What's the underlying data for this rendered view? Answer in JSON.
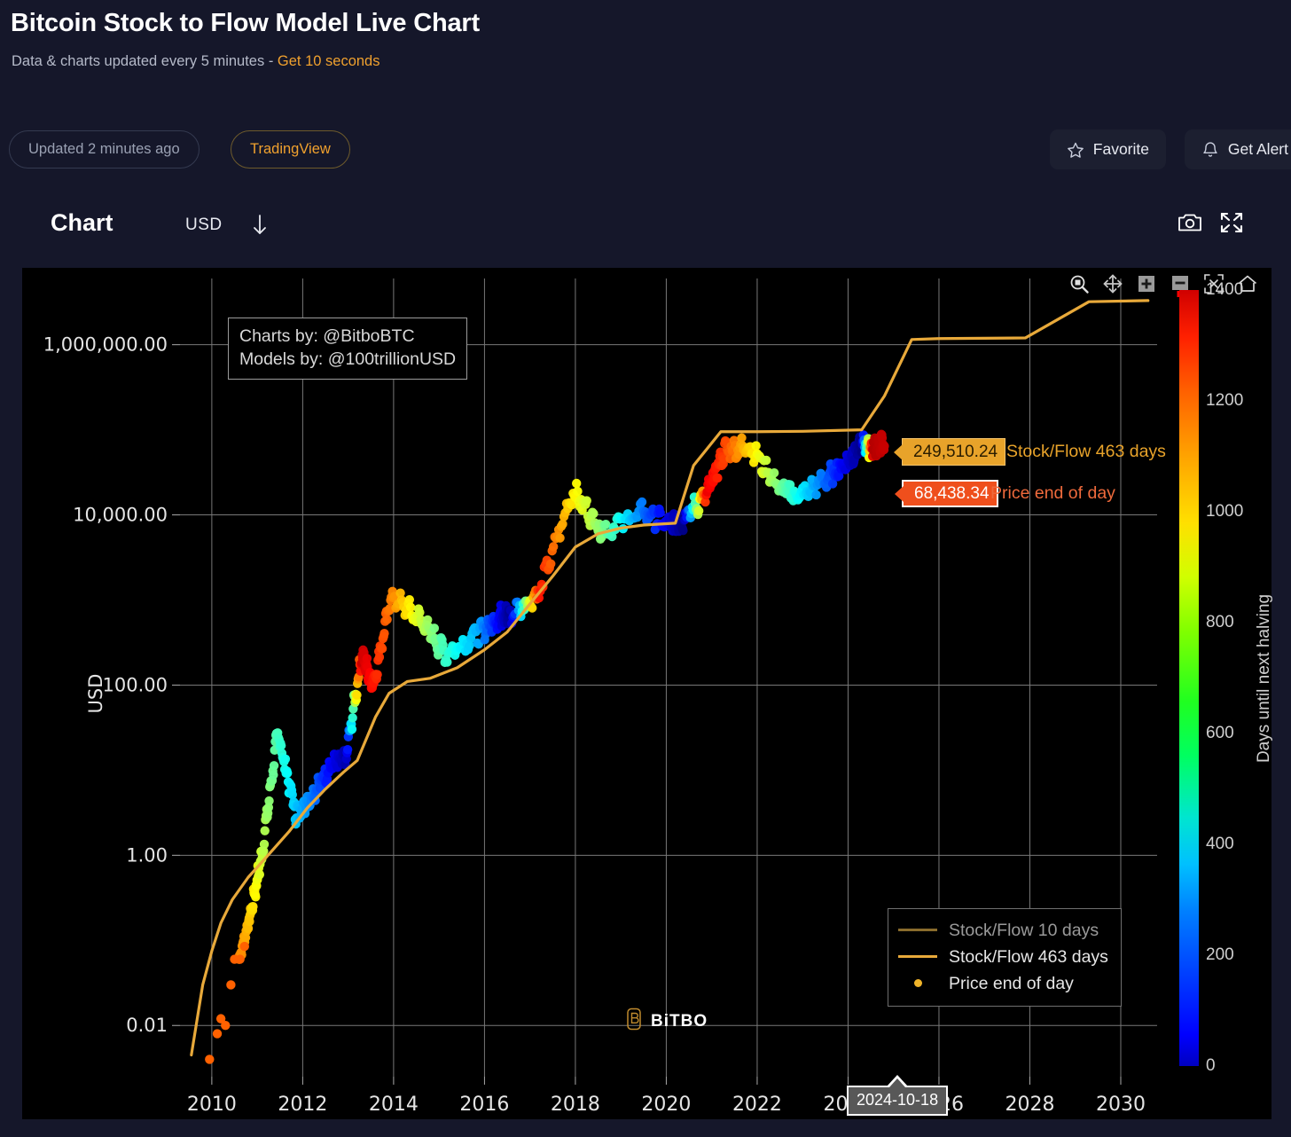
{
  "header": {
    "title": "Bitcoin Stock to Flow Model Live Chart",
    "subtitle_plain": "Data & charts updated every 5 minutes - ",
    "subtitle_accent": "Get 10 seconds",
    "updated_pill": "Updated 2 minutes ago",
    "tradingview_pill": "TradingView",
    "favorite_label": "Favorite",
    "alert_label": "Get Alert"
  },
  "chart_header": {
    "label": "Chart",
    "currency": "USD",
    "currency_arrow": "down-arrow-icon",
    "camera_icon": "camera-icon",
    "expand_icon": "expand-icon"
  },
  "chart_toolbar": {
    "items": [
      "zoom-box-icon",
      "pan-icon",
      "zoom-in-icon",
      "zoom-out-icon",
      "autoscale-icon",
      "home-icon"
    ]
  },
  "credits": {
    "line1": "Charts by: @BitboBTC",
    "line2": "Models by: @100trillionUSD"
  },
  "flags": {
    "stockflow_value": "249,510.24",
    "stockflow_label": "Stock/Flow 463 days",
    "price_value": "68,438.34",
    "price_label": "Price end of day"
  },
  "legend": {
    "items": [
      {
        "label": "Stock/Flow 10 days",
        "color": "#8a6c2d",
        "text_color": "#9a9a9a",
        "kind": "line"
      },
      {
        "label": "Stock/Flow 463 days",
        "color": "#e8a93a",
        "text_color": "#e6e6e6",
        "kind": "line"
      },
      {
        "label": "Price end of day",
        "color": "#f0b42a",
        "text_color": "#e6e6e6",
        "kind": "dot"
      }
    ]
  },
  "watermark": {
    "text": "BiTBO",
    "icon": "bitbo-logo-icon"
  },
  "x_tooltip": {
    "date": "2024-10-18"
  },
  "colors": {
    "page_bg": "#15172a",
    "chart_bg": "#000000",
    "accent": "#f0a12e",
    "stockflow_463": "#e8a93a",
    "stockflow_10": "#8a6c2d",
    "price_flag": "#ef4f1c",
    "grid": "#787878"
  },
  "chart_data": {
    "type": "scatter",
    "title": "Bitcoin Stock to Flow Model Live Chart",
    "xlabel": "",
    "ylabel": "USD",
    "yscale": "log",
    "xlim": [
      2009.3,
      2030.8
    ],
    "ylim": [
      0.0025,
      6000000
    ],
    "grid": true,
    "legend_position": "lower right",
    "xticks": [
      2010,
      2012,
      2014,
      2016,
      2018,
      2020,
      2022,
      2024,
      2026,
      2028,
      2030
    ],
    "xtick_labels": [
      "2010",
      "2012",
      "2014",
      "2016",
      "2018",
      "2020",
      "2022",
      "2024",
      "2026",
      "2028",
      "2030"
    ],
    "yticks": [
      0.01,
      1,
      100,
      10000,
      1000000
    ],
    "ytick_labels": [
      "0.01",
      "1.00",
      "100.00",
      "10,000.00",
      "1,000,000.00"
    ],
    "colorbar": {
      "label": "Days until next halving",
      "ticks": [
        0,
        200,
        400,
        600,
        800,
        1000,
        1200,
        1400
      ],
      "vmin": 0,
      "vmax": 1400,
      "colormap": "jet"
    },
    "series": [
      {
        "name": "Stock/Flow 463 days",
        "kind": "line",
        "color": "#e8a93a",
        "points": [
          [
            2009.55,
            0.0045
          ],
          [
            2009.8,
            0.03
          ],
          [
            2010.0,
            0.075
          ],
          [
            2010.2,
            0.16
          ],
          [
            2010.45,
            0.3
          ],
          [
            2010.8,
            0.55
          ],
          [
            2011.2,
            0.95
          ],
          [
            2011.7,
            1.9
          ],
          [
            2012.1,
            3.6
          ],
          [
            2012.5,
            6.0
          ],
          [
            2012.9,
            9.5
          ],
          [
            2013.2,
            13.0
          ],
          [
            2013.6,
            42.0
          ],
          [
            2013.9,
            80.0
          ],
          [
            2014.3,
            110.0
          ],
          [
            2014.8,
            120.0
          ],
          [
            2015.4,
            160.0
          ],
          [
            2016.0,
            260.0
          ],
          [
            2016.5,
            420.0
          ],
          [
            2017.0,
            900.0
          ],
          [
            2017.5,
            1900.0
          ],
          [
            2018.0,
            4200.0
          ],
          [
            2018.5,
            6000.0
          ],
          [
            2019.0,
            7000.0
          ],
          [
            2019.5,
            7600.0
          ],
          [
            2020.2,
            8000.0
          ],
          [
            2020.6,
            38000.0
          ],
          [
            2021.2,
            95000.0
          ],
          [
            2022.0,
            95000.0
          ],
          [
            2023.0,
            96000.0
          ],
          [
            2024.3,
            100000.0
          ],
          [
            2024.8,
            249510.24
          ],
          [
            2025.4,
            1150000.0
          ],
          [
            2026.0,
            1180000.0
          ],
          [
            2027.9,
            1200000.0
          ],
          [
            2029.3,
            3200000.0
          ],
          [
            2030.6,
            3300000.0
          ]
        ]
      },
      {
        "name": "Stock/Flow 10 days",
        "kind": "line",
        "color": "#8a6c2d"
      },
      {
        "name": "Price end of day",
        "kind": "scatter",
        "color_by": "days_until_next_halving",
        "last_value": 68438.34,
        "last_date": "2024-10-18",
        "key_points": [
          {
            "date": 2010.6,
            "price": 0.06,
            "days": 1050
          },
          {
            "date": 2010.85,
            "price": 0.2,
            "days": 950
          },
          {
            "date": 2011.1,
            "price": 1.0,
            "days": 800
          },
          {
            "date": 2011.45,
            "price": 28.0,
            "days": 620
          },
          {
            "date": 2011.85,
            "price": 3.0,
            "days": 450
          },
          {
            "date": 2012.2,
            "price": 5.0,
            "days": 350
          },
          {
            "date": 2012.6,
            "price": 11.0,
            "days": 180
          },
          {
            "date": 2012.95,
            "price": 13.5,
            "days": 60
          },
          {
            "date": 2013.3,
            "price": 230.0,
            "days": 1300
          },
          {
            "date": 2013.55,
            "price": 100.0,
            "days": 1200
          },
          {
            "date": 2013.95,
            "price": 1100.0,
            "days": 1050
          },
          {
            "date": 2014.6,
            "price": 580.0,
            "days": 800
          },
          {
            "date": 2015.15,
            "price": 230.0,
            "days": 600
          },
          {
            "date": 2015.9,
            "price": 420.0,
            "days": 400
          },
          {
            "date": 2016.35,
            "price": 650.0,
            "days": 150
          },
          {
            "date": 2016.55,
            "price": 660.0,
            "days": 30
          },
          {
            "date": 2017.2,
            "price": 1200.0,
            "days": 1200
          },
          {
            "date": 2017.95,
            "price": 19500.0,
            "days": 900
          },
          {
            "date": 2018.6,
            "price": 6400.0,
            "days": 700
          },
          {
            "date": 2019.5,
            "price": 11000.0,
            "days": 330
          },
          {
            "date": 2020.1,
            "price": 7200.0,
            "days": 110
          },
          {
            "date": 2020.37,
            "price": 8700.0,
            "days": 10
          },
          {
            "date": 2020.9,
            "price": 18000.0,
            "days": 1250
          },
          {
            "date": 2021.3,
            "price": 58000.0,
            "days": 1130
          },
          {
            "date": 2021.85,
            "price": 64000.0,
            "days": 930
          },
          {
            "date": 2022.5,
            "price": 20000.0,
            "days": 690
          },
          {
            "date": 2022.95,
            "price": 16500.0,
            "days": 520
          },
          {
            "date": 2023.6,
            "price": 29000.0,
            "days": 280
          },
          {
            "date": 2024.0,
            "price": 43000.0,
            "days": 120
          },
          {
            "date": 2024.3,
            "price": 70000.0,
            "days": 10
          },
          {
            "date": 2024.55,
            "price": 62000.0,
            "days": 1330
          },
          {
            "date": 2024.8,
            "price": 68438.34,
            "days": 1300
          }
        ]
      }
    ]
  }
}
